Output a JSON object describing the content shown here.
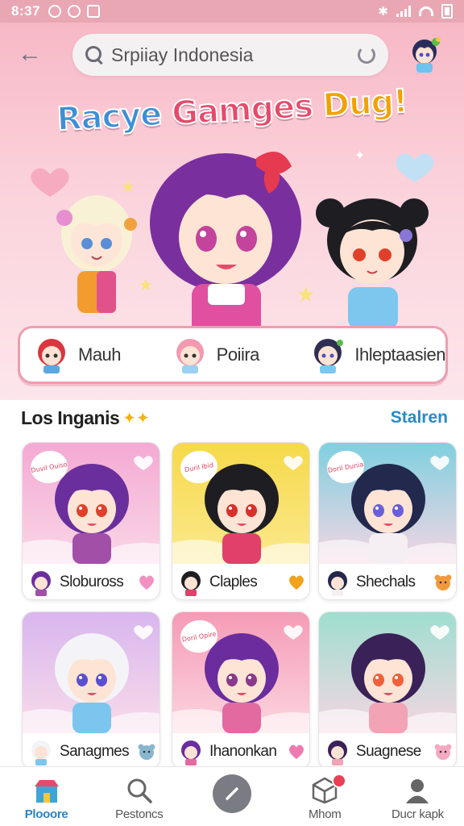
{
  "status_bar": {
    "time": "8:37"
  },
  "header": {
    "search_value": "Srpiiay Indonesia"
  },
  "hero": {
    "title_parts": [
      {
        "text": "Racye ",
        "color": "#3d8fd8"
      },
      {
        "text": "Gamges ",
        "color": "#e64a6a"
      },
      {
        "text": "Dug!",
        "color": "#f2a200"
      }
    ]
  },
  "characters": [
    {
      "label": "Mauh",
      "hair": "#d9363f",
      "outfit": "#5ba8e0"
    },
    {
      "label": "Poiira",
      "hair": "#f29ab0",
      "outfit": "#9ad0f0"
    },
    {
      "label": "Ihleptaasien",
      "hair": "#2e2f52",
      "outfit": "#7cc7f0"
    }
  ],
  "section": {
    "title": "Los Inganis",
    "link": "Stalren"
  },
  "cards": [
    {
      "name": "Slobuross",
      "bg1": "#f4a9d3",
      "bg2": "#f9d7e6",
      "hair": "#6a2f9c",
      "eyes": "#e0402a",
      "outfit": "#a24fa8",
      "badge": "heart",
      "badge_color": "#f291c1",
      "bubble": "Duvil Ouiso"
    },
    {
      "name": "Claples",
      "bg1": "#f6d94a",
      "bg2": "#fbe98e",
      "hair": "#1e1e22",
      "eyes": "#d8302a",
      "outfit": "#e0406a",
      "badge": "heart",
      "badge_color": "#f2a21b",
      "bubble": "Duril Ibid"
    },
    {
      "name": "Shechals",
      "bg1": "#7fd0e0",
      "bg2": "#f6d5e2",
      "hair": "#23284d",
      "eyes": "#6a5fd8",
      "outfit": "#f5eef2",
      "badge": "bear",
      "badge_color": "#f09a3c",
      "bubble": "Doril Dunia"
    },
    {
      "name": "Sanagmes",
      "bg1": "#d8b6ef",
      "bg2": "#f8dce9",
      "hair": "#f4f4f8",
      "eyes": "#5a4fd2",
      "outfit": "#7cc5ee",
      "badge": "cat",
      "badge_color": "#89b6cf",
      "bubble": ""
    },
    {
      "name": "Ihanonkan",
      "bg1": "#f59bb6",
      "bg2": "#fbd6e0",
      "hair": "#6b2c9e",
      "eyes": "#8a3a8a",
      "outfit": "#e36aa1",
      "badge": "heart",
      "badge_color": "#f07ab0",
      "bubble": "Doril Opire"
    },
    {
      "name": "Suagnese",
      "bg1": "#9fded0",
      "bg2": "#f5d6e2",
      "hair": "#3a2157",
      "eyes": "#f0603a",
      "outfit": "#f2a3b6",
      "badge": "pig",
      "badge_color": "#f4a9c3",
      "bubble": ""
    }
  ],
  "nav": [
    {
      "label": "Plooore",
      "icon": "shop-icon",
      "active": true
    },
    {
      "label": "Pestoncs",
      "icon": "search-icon",
      "active": false
    },
    {
      "label": "",
      "icon": "edit-icon",
      "active": false
    },
    {
      "label": "Mhom",
      "icon": "box-icon",
      "active": false
    },
    {
      "label": "Ducr kapk",
      "icon": "profile-icon",
      "active": false
    }
  ],
  "colors": {
    "accent_blue": "#2a8ac4",
    "hero_pink": "#f7b8c6",
    "pill_border": "#ee9db1"
  }
}
